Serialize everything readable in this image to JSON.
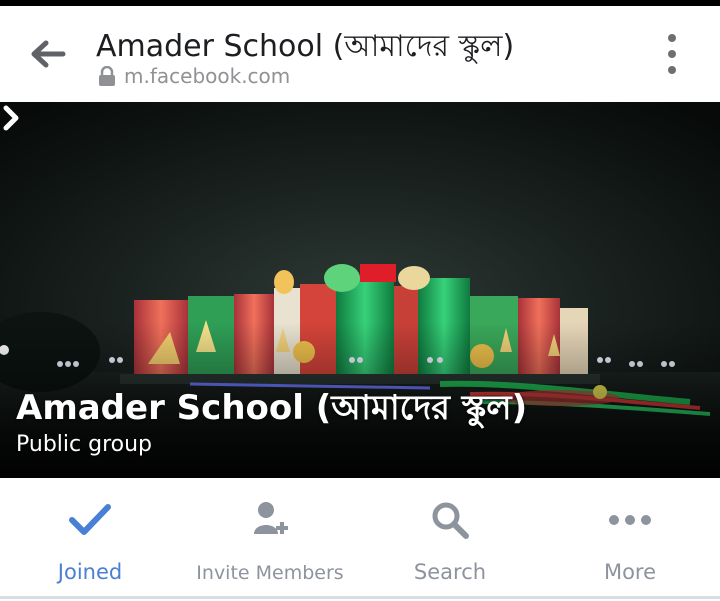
{
  "header": {
    "title": "Amader School (আমাদের স্কুল)",
    "url": "m.facebook.com",
    "back_icon": "arrow-left-icon",
    "lock_icon": "lock-icon",
    "menu_icon": "more-vertical-icon"
  },
  "cover": {
    "group_name": "Amader School (আমাদের স্কুল)",
    "privacy": "Public group",
    "chevron_icon": "chevron-right-icon"
  },
  "actions": [
    {
      "label": "Joined",
      "icon": "checkmark-icon",
      "color": "#4a7fd6"
    },
    {
      "label": "Invite Members",
      "icon": "add-person-icon",
      "color": "#8d949e"
    },
    {
      "label": "Search",
      "icon": "search-icon",
      "color": "#8d949e"
    },
    {
      "label": "More",
      "icon": "more-horizontal-icon",
      "color": "#8d949e"
    }
  ]
}
